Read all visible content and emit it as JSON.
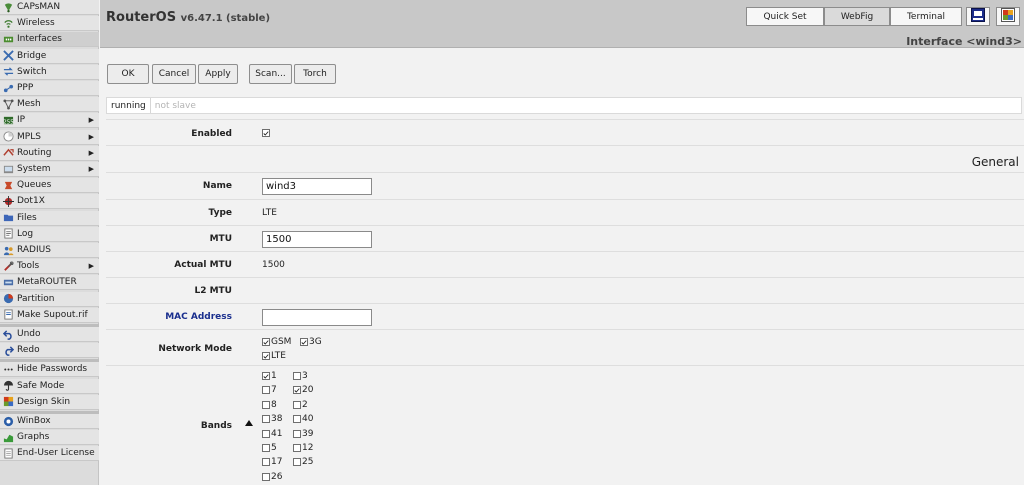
{
  "sidebar": {
    "items": [
      {
        "label": "CAPsMAN",
        "icon": "capsman-icon",
        "arrow": false,
        "active": false
      },
      {
        "label": "Wireless",
        "icon": "wireless-icon",
        "arrow": false,
        "active": false
      },
      {
        "label": "Interfaces",
        "icon": "interfaces-icon",
        "arrow": false,
        "active": true
      },
      {
        "label": "Bridge",
        "icon": "bridge-icon",
        "arrow": false,
        "active": false
      },
      {
        "label": "Switch",
        "icon": "switch-icon",
        "arrow": false,
        "active": false
      },
      {
        "label": "PPP",
        "icon": "ppp-icon",
        "arrow": false,
        "active": false
      },
      {
        "label": "Mesh",
        "icon": "mesh-icon",
        "arrow": false,
        "active": false
      },
      {
        "label": "IP",
        "icon": "ip-icon",
        "arrow": true,
        "active": false
      },
      {
        "label": "MPLS",
        "icon": "mpls-icon",
        "arrow": true,
        "active": false
      },
      {
        "label": "Routing",
        "icon": "routing-icon",
        "arrow": true,
        "active": false
      },
      {
        "label": "System",
        "icon": "system-icon",
        "arrow": true,
        "active": false
      },
      {
        "label": "Queues",
        "icon": "queues-icon",
        "arrow": false,
        "active": false
      },
      {
        "label": "Dot1X",
        "icon": "dot1x-icon",
        "arrow": false,
        "active": false
      },
      {
        "label": "Files",
        "icon": "files-icon",
        "arrow": false,
        "active": false
      },
      {
        "label": "Log",
        "icon": "log-icon",
        "arrow": false,
        "active": false
      },
      {
        "label": "RADIUS",
        "icon": "radius-icon",
        "arrow": false,
        "active": false
      },
      {
        "label": "Tools",
        "icon": "tools-icon",
        "arrow": true,
        "active": false
      },
      {
        "label": "MetaROUTER",
        "icon": "metarouter-icon",
        "arrow": false,
        "active": false
      },
      {
        "label": "Partition",
        "icon": "partition-icon",
        "arrow": false,
        "active": false
      },
      {
        "label": "Make Supout.rif",
        "icon": "make-supout-icon",
        "arrow": false,
        "active": false
      },
      {
        "label": "Undo",
        "icon": "undo-icon",
        "arrow": false,
        "active": false
      },
      {
        "label": "Redo",
        "icon": "redo-icon",
        "arrow": false,
        "active": false
      },
      {
        "label": "Hide Passwords",
        "icon": "hide-passwords-icon",
        "arrow": false,
        "active": false
      },
      {
        "label": "Safe Mode",
        "icon": "safe-mode-icon",
        "arrow": false,
        "active": false
      },
      {
        "label": "Design Skin",
        "icon": "design-skin-icon",
        "arrow": false,
        "active": false
      },
      {
        "label": "WinBox",
        "icon": "winbox-icon",
        "arrow": false,
        "active": false
      },
      {
        "label": "Graphs",
        "icon": "graphs-icon",
        "arrow": false,
        "active": false
      },
      {
        "label": "End-User License",
        "icon": "license-icon",
        "arrow": false,
        "active": false
      }
    ]
  },
  "header": {
    "product": "RouterOS",
    "version": "v6.47.1 (stable)",
    "modes": [
      "Quick Set",
      "WebFig",
      "Terminal"
    ],
    "active_mode": "WebFig",
    "page_title": "Interface <wind3>"
  },
  "toolbar": {
    "ok": "OK",
    "cancel": "Cancel",
    "apply": "Apply",
    "scan": "Scan...",
    "torch": "Torch"
  },
  "status": {
    "running": "running",
    "slave": "not slave"
  },
  "form": {
    "enabled_label": "Enabled",
    "enabled": true,
    "section": "General",
    "name_label": "Name",
    "name_value": "wind3",
    "type_label": "Type",
    "type_value": "LTE",
    "mtu_label": "MTU",
    "mtu_value": "1500",
    "actual_mtu_label": "Actual MTU",
    "actual_mtu_value": "1500",
    "l2mtu_label": "L2 MTU",
    "l2mtu_value": "",
    "mac_label": "MAC Address",
    "mac_value": "",
    "network_mode_label": "Network Mode",
    "network_modes": [
      {
        "label": "GSM",
        "checked": true
      },
      {
        "label": "3G",
        "checked": true
      },
      {
        "label": "LTE",
        "checked": true
      }
    ],
    "bands_label": "Bands",
    "bands": [
      {
        "label": "1",
        "checked": true
      },
      {
        "label": "3",
        "checked": false
      },
      {
        "label": "7",
        "checked": false
      },
      {
        "label": "20",
        "checked": true
      },
      {
        "label": "8",
        "checked": false
      },
      {
        "label": "2",
        "checked": false
      },
      {
        "label": "38",
        "checked": false
      },
      {
        "label": "40",
        "checked": false
      },
      {
        "label": "41",
        "checked": false
      },
      {
        "label": "39",
        "checked": false
      },
      {
        "label": "5",
        "checked": false
      },
      {
        "label": "12",
        "checked": false
      },
      {
        "label": "17",
        "checked": false
      },
      {
        "label": "25",
        "checked": false
      },
      {
        "label": "26",
        "checked": false
      }
    ]
  },
  "colors": {
    "topbar": "#c8c8c8",
    "sidebar": "#dcdcdc",
    "link_label": "#1a2f8e"
  }
}
